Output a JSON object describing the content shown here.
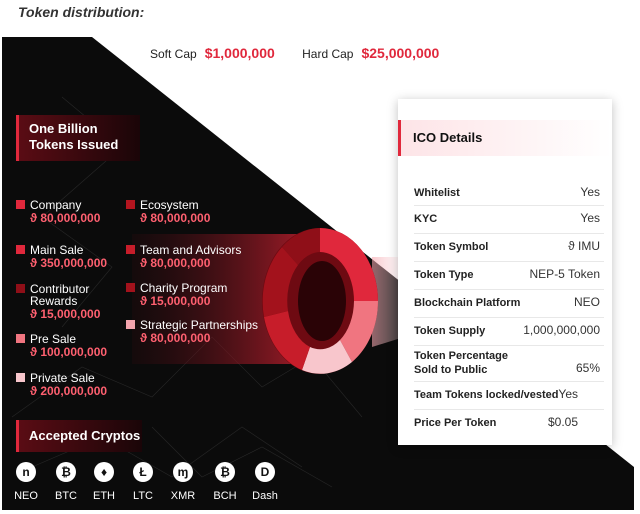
{
  "section_title": "Token distribution:",
  "caps": {
    "soft_label": "Soft Cap",
    "soft_value": "$1,000,000",
    "hard_label": "Hard Cap",
    "hard_value": "$25,000,000"
  },
  "billion": {
    "line1": "One Billion",
    "line2": "Tokens Issued"
  },
  "distribution": [
    {
      "name": "Company",
      "amount": "ϑ 80,000,000",
      "color": "#e0283c"
    },
    {
      "name": "Ecosystem",
      "amount": "ϑ 80,000,000",
      "color": "#b3151f"
    },
    {
      "name": "Main Sale",
      "amount": "ϑ 350,000,000",
      "color": "#e0283c"
    },
    {
      "name": "Team and Advisors",
      "amount": "ϑ 80,000,000",
      "color": "#c71d2a"
    },
    {
      "name_line1": "Contributor",
      "name_line2": "Rewards",
      "amount": "ϑ 15,000,000",
      "color": "#8f0f18"
    },
    {
      "name": "Charity Program",
      "amount": "ϑ 15,000,000",
      "color": "#a3121c"
    },
    {
      "name": "Pre Sale",
      "amount": "ϑ 100,000,000",
      "color": "#f07580"
    },
    {
      "name": "Strategic Partnerships",
      "amount": "ϑ 80,000,000",
      "color": "#f3a4ad"
    },
    {
      "name": "Private Sale",
      "amount": "ϑ 200,000,000",
      "color": "#f8c6cc"
    }
  ],
  "accepted_title": "Accepted Cryptos",
  "cryptos": [
    {
      "name": "NEO",
      "glyph": "n",
      "icon": "neo-icon"
    },
    {
      "name": "BTC",
      "glyph": "₿",
      "icon": "btc-icon"
    },
    {
      "name": "ETH",
      "glyph": "♦",
      "icon": "eth-icon"
    },
    {
      "name": "LTC",
      "glyph": "Ł",
      "icon": "ltc-icon"
    },
    {
      "name": "XMR",
      "glyph": "ɱ",
      "icon": "xmr-icon"
    },
    {
      "name": "BCH",
      "glyph": "₿",
      "icon": "bch-icon"
    },
    {
      "name": "Dash",
      "glyph": "D",
      "icon": "dash-icon"
    }
  ],
  "ico": {
    "title": "ICO Details",
    "rows": [
      {
        "k": "Whitelist",
        "v": "Yes"
      },
      {
        "k": "KYC",
        "v": "Yes"
      },
      {
        "k": "Token Symbol",
        "v": "ϑ IMU"
      },
      {
        "k": "Token Type",
        "v": "NEP-5 Token"
      },
      {
        "k": "Blockchain Platform",
        "v": "NEO"
      },
      {
        "k": "Token Supply",
        "v": "1,000,000,000"
      },
      {
        "k_line1": "Token Percentage",
        "k_line2": "Sold to Public",
        "v": "65%"
      },
      {
        "k": "Team Tokens locked/vested",
        "v": "Yes"
      },
      {
        "k": "Price Per Token",
        "v": "$0.05"
      }
    ]
  },
  "colors": {
    "accent": "#e0283c",
    "background_dark": "#0b0b0b"
  }
}
